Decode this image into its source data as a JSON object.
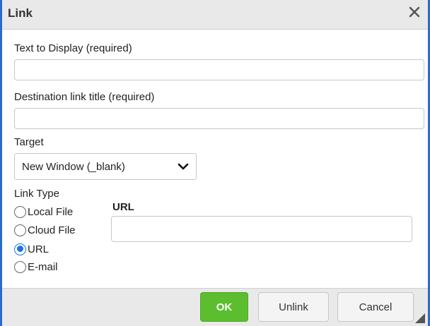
{
  "dialog": {
    "title": "Link",
    "close_icon": "close-icon"
  },
  "fields": {
    "text_to_display": {
      "label": "Text to Display (required)",
      "value": ""
    },
    "destination_title": {
      "label": "Destination link title (required)",
      "value": ""
    },
    "target": {
      "label": "Target",
      "selected": "New Window (_blank)"
    }
  },
  "link_type": {
    "label": "Link Type",
    "options": [
      {
        "label": "Local File",
        "checked": false
      },
      {
        "label": "Cloud File",
        "checked": false
      },
      {
        "label": "URL",
        "checked": true
      },
      {
        "label": "E-mail",
        "checked": false
      }
    ]
  },
  "url": {
    "heading": "URL",
    "value": ""
  },
  "buttons": {
    "ok": "OK",
    "unlink": "Unlink",
    "cancel": "Cancel"
  },
  "colors": {
    "accent": "#2a6cc7",
    "ok_green": "#5cbd2f",
    "radio_selected": "#1a73e8"
  }
}
